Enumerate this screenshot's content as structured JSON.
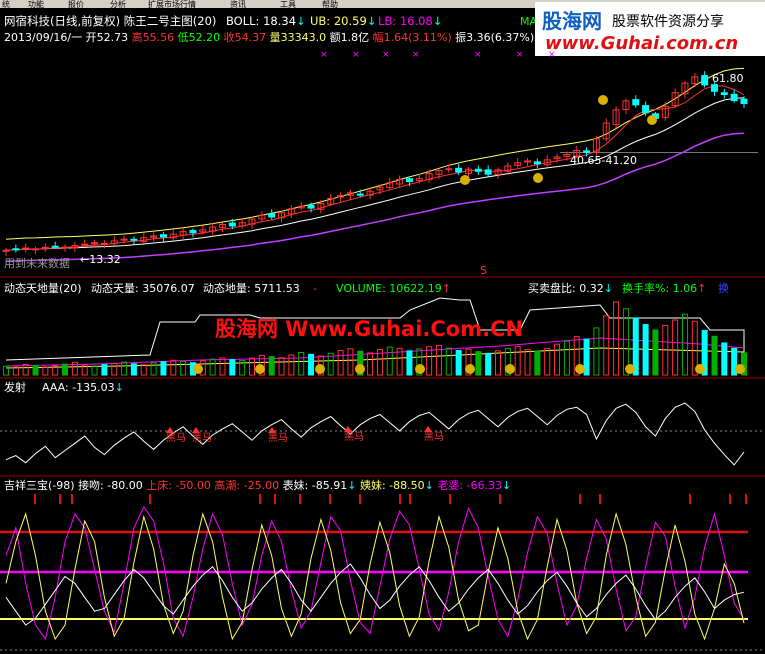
{
  "menu_bar": {
    "items": [
      "统",
      "功能",
      "报价",
      "分析",
      "扩展市场行情",
      "资讯",
      "工具",
      "帮助"
    ]
  },
  "watermarks": {
    "top_logo_text": "股海网",
    "top_slogan": "股票软件资源分享",
    "top_url": "www.Guhai.com.cn",
    "center_text": "股海网 Www.Guhai.Com.CN"
  },
  "main_panel": {
    "title": "网宿科技(日线,前复权)",
    "indicator": "陈王二号主图(20)",
    "boll": "BOLL: 18.34",
    "boll_arrow": "↓",
    "ub": "UB: 20.59",
    "ub_arrow": "↓",
    "lb": "LB: 16.08",
    "lb_arrow": "↓",
    "ma_label": "MA5",
    "date": "2013/09/16/一",
    "open": "开52.73",
    "high": "高55.56",
    "low": "低52.20",
    "close": "收54.37",
    "volume": "量33343.0",
    "amount": "额1.8亿",
    "change": "幅1.64(3.11%)",
    "amplitude": "振3.36(6.37%)",
    "extra": "换",
    "high_price_label": "61.80",
    "mid_label": "40.65-41.20",
    "low_label": "←13.32",
    "future_label": "用到未来数据",
    "signal_s": "S"
  },
  "volume_panel": {
    "title": "动态天地量(20)",
    "sky": "动态天量: 35076.07",
    "ground": "动态地量: 5711.53",
    "dash": "-",
    "volume": "VOLUME: 10622.19",
    "volume_arrow": "↑",
    "buy_sell": "买卖盘比: 0.32",
    "buy_sell_arrow": "↓",
    "turnover": "换手率%: 1.06",
    "turnover_arrow": "↑",
    "extra": "换"
  },
  "fire_panel": {
    "title": "发射",
    "aaa": "AAA: -135.03",
    "aaa_arrow": "↓",
    "labels": [
      "黑马",
      "黑马",
      "黑马",
      "黑马",
      "黑马"
    ]
  },
  "jx_panel": {
    "title": "吉祥三宝(-98)",
    "jw": "接吻: -80.00",
    "sc": "上床: -50.00",
    "gc": "高潮: -25.00",
    "bm": "表妹: -85.91",
    "bm_arrow": "↓",
    "ym": "姨妹: -88.50",
    "ym_arrow": "↓",
    "lp": "老婆: -66.33",
    "lp_arrow": "↓"
  },
  "colors": {
    "price_up": "#ff3232",
    "price_down": "#00ffff",
    "green_bar": "#00b000",
    "white": "#ffffff",
    "yellow": "#ffff66",
    "magenta": "#ff00ff",
    "purple": "#c040ff",
    "red_line": "#e01010",
    "gold": "#d8b000"
  },
  "chart_data": [
    {
      "type": "candlestick",
      "title": "网宿科技(日线,前复权)",
      "price_labels": [
        61.8,
        40.65,
        41.2,
        13.32
      ],
      "close_series": [
        13.3,
        13.6,
        13.9,
        13.7,
        14.1,
        14.4,
        14.2,
        14.6,
        15.0,
        15.4,
        15.2,
        15.9,
        16.4,
        16.1,
        16.8,
        17.3,
        17.0,
        17.8,
        18.5,
        18.2,
        19.0,
        19.8,
        20.5,
        20.1,
        21.0,
        22.0,
        23.1,
        22.6,
        23.8,
        24.9,
        25.6,
        25.1,
        26.4,
        27.8,
        28.6,
        29.4,
        28.7,
        29.8,
        31.0,
        32.2,
        33.1,
        32.5,
        33.4,
        34.8,
        35.6,
        36.1,
        35.2,
        36.0,
        35.4,
        34.6,
        35.8,
        36.9,
        37.8,
        38.3,
        37.5,
        38.6,
        39.4,
        40.1,
        41.2,
        40.65,
        44.5,
        48.9,
        52.6,
        55.1,
        54.0,
        51.8,
        50.2,
        53.6,
        57.4,
        60.1,
        61.8,
        59.6,
        57.8,
        56.9,
        55.2,
        54.37
      ]
    },
    {
      "type": "bar",
      "title": "动态天地量(20)",
      "series": [
        {
          "name": "VOLUME",
          "values": [
            4200,
            3800,
            5100,
            4600,
            3900,
            4400,
            5200,
            6100,
            4800,
            4300,
            5000,
            5600,
            6200,
            5400,
            4900,
            5800,
            6400,
            7100,
            6600,
            5900,
            6800,
            7600,
            8200,
            7400,
            6900,
            8100,
            9400,
            8800,
            8300,
            9600,
            10800,
            9900,
            9100,
            10400,
            11800,
            12600,
            11400,
            10600,
            12200,
            13400,
            12800,
            11600,
            12500,
            13600,
            14200,
            12900,
            11800,
            12400,
            11200,
            10400,
            11600,
            12800,
            13600,
            12200,
            11400,
            12800,
            14800,
            16200,
            18400,
            17200,
            22600,
            28400,
            35076,
            31800,
            27400,
            24200,
            21600,
            23800,
            26400,
            29200,
            25800,
            21400,
            18600,
            15400,
            12800,
            10622
          ]
        }
      ]
    },
    {
      "type": "line",
      "title": "发射",
      "series": [
        {
          "name": "AAA",
          "values": [
            -150,
            -142,
            -156,
            -138,
            -124,
            -146,
            -132,
            -118,
            -104,
            -126,
            -140,
            -122,
            -108,
            -96,
            -114,
            -130,
            -112,
            -98,
            -86,
            -104,
            -120,
            -102,
            -90,
            -80,
            -96,
            -112,
            -94,
            -82,
            -72,
            -90,
            -106,
            -88,
            -76,
            -66,
            -84,
            -100,
            -82,
            -70,
            -62,
            -78,
            -94,
            -76,
            -64,
            -58,
            -74,
            -90,
            -72,
            -60,
            -54,
            -70,
            -86,
            -68,
            -56,
            -50,
            -66,
            -82,
            -64,
            -52,
            -48,
            -62,
            -110,
            -74,
            -50,
            -42,
            -58,
            -86,
            -104,
            -70,
            -48,
            -40,
            -56,
            -92,
            -118,
            -140,
            -160,
            -135.03
          ]
        }
      ]
    },
    {
      "type": "line",
      "title": "吉祥三宝(-98)",
      "reference_levels": {
        "接吻": -80.0,
        "上床": -50.0,
        "高潮": -25.0
      },
      "series": [
        {
          "name": "表妹",
          "values": [
            -40,
            -20,
            -60,
            -90,
            -100,
            -70,
            -30,
            -10,
            -20,
            -50,
            -80,
            -95,
            -60,
            -20,
            -5,
            -15,
            -45,
            -85,
            -98,
            -70,
            -35,
            -10,
            -25,
            -60,
            -90,
            -75,
            -40,
            -15,
            -30,
            -65,
            -92,
            -80,
            -45,
            -12,
            -22,
            -58,
            -88,
            -96,
            -62,
            -28,
            -8,
            -18,
            -50,
            -82,
            -94,
            -66,
            -30,
            -6,
            -20,
            -55,
            -86,
            -98,
            -72,
            -38,
            -12,
            -24,
            -60,
            -90,
            -76,
            -42,
            -14,
            -28,
            -64,
            -94,
            -84,
            -48,
            -16,
            -26,
            -62,
            -92,
            -70,
            -34,
            -10,
            -40,
            -74,
            -85.91
          ]
        },
        {
          "name": "姨妹",
          "values": [
            -60,
            -30,
            -10,
            -40,
            -80,
            -100,
            -90,
            -50,
            -15,
            -30,
            -70,
            -98,
            -85,
            -45,
            -12,
            -35,
            -75,
            -96,
            -80,
            -40,
            -10,
            -30,
            -70,
            -100,
            -88,
            -50,
            -18,
            -40,
            -78,
            -98,
            -82,
            -42,
            -14,
            -36,
            -74,
            -96,
            -86,
            -46,
            -16,
            -38,
            -76,
            -98,
            -84,
            -44,
            -12,
            -34,
            -72,
            -94,
            -90,
            -52,
            -20,
            -42,
            -80,
            -100,
            -86,
            -48,
            -14,
            -36,
            -74,
            -96,
            -84,
            -40,
            -10,
            -32,
            -70,
            -98,
            -88,
            -50,
            -18,
            -44,
            -82,
            -100,
            -78,
            -46,
            -60,
            -88.5
          ]
        },
        {
          "name": "老婆",
          "values": [
            -70,
            -80,
            -90,
            -85,
            -75,
            -65,
            -55,
            -60,
            -70,
            -80,
            -78,
            -68,
            -58,
            -50,
            -56,
            -66,
            -76,
            -82,
            -72,
            -62,
            -54,
            -48,
            -58,
            -70,
            -80,
            -74,
            -64,
            -56,
            -50,
            -60,
            -72,
            -80,
            -70,
            -60,
            -52,
            -46,
            -56,
            -68,
            -78,
            -72,
            -62,
            -54,
            -48,
            -58,
            -70,
            -80,
            -74,
            -64,
            -56,
            -50,
            -60,
            -72,
            -82,
            -76,
            -66,
            -58,
            -52,
            -62,
            -74,
            -84,
            -78,
            -68,
            -60,
            -54,
            -64,
            -76,
            -86,
            -80,
            -70,
            -62,
            -56,
            -66,
            -78,
            -72,
            -68,
            -66.33
          ]
        }
      ]
    }
  ]
}
